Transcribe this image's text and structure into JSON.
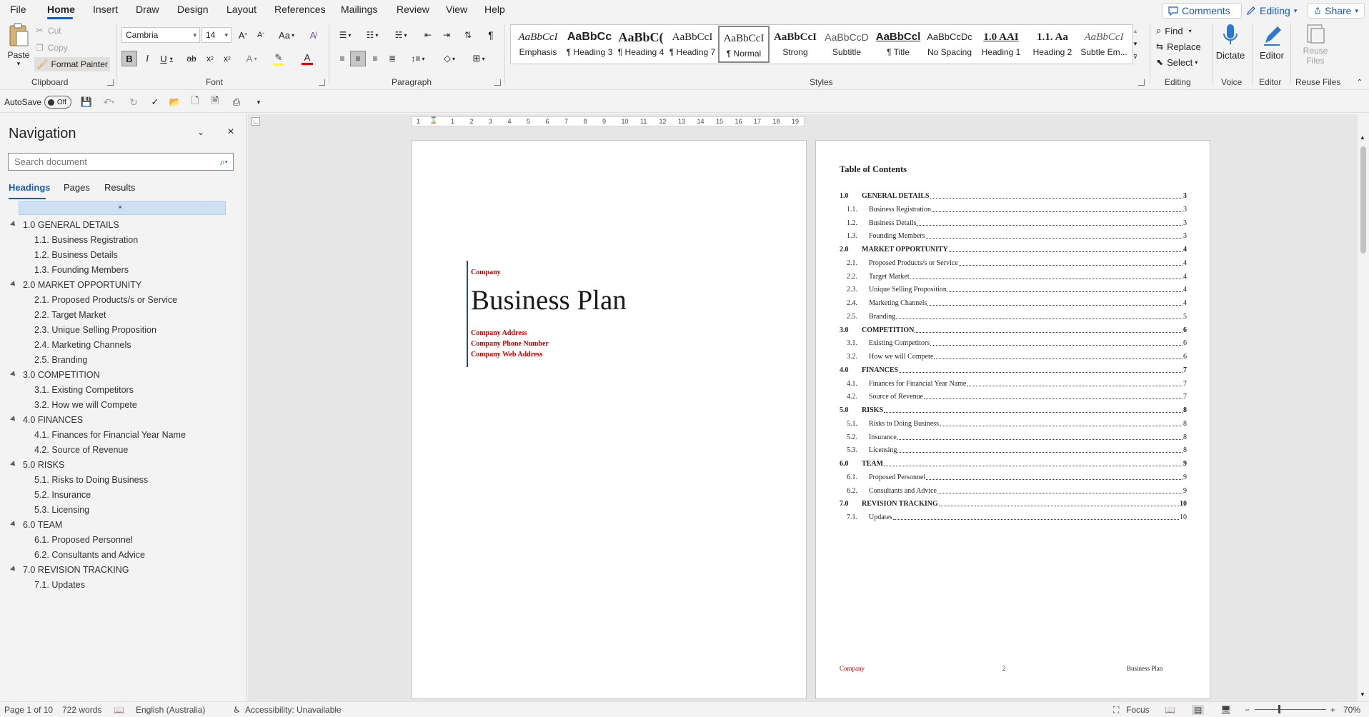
{
  "menu": {
    "tabs": [
      "File",
      "Home",
      "Insert",
      "Draw",
      "Design",
      "Layout",
      "References",
      "Mailings",
      "Review",
      "View",
      "Help"
    ],
    "comments_label": "Comments",
    "editing_label": "Editing",
    "share_label": "Share"
  },
  "ribbon": {
    "clipboard": {
      "paste": "Paste",
      "cut": "Cut",
      "copy": "Copy",
      "format_painter": "Format Painter",
      "group": "Clipboard"
    },
    "font": {
      "name": "Cambria",
      "size": "14",
      "group": "Font",
      "change_case": "Aa"
    },
    "paragraph": {
      "group": "Paragraph"
    },
    "styles": {
      "group": "Styles",
      "items": [
        {
          "preview": "AaBbCcI",
          "name": "Emphasis"
        },
        {
          "preview": "AaBbCc",
          "name": "¶ Heading 3"
        },
        {
          "preview": "AaBbC(",
          "name": "¶ Heading 4"
        },
        {
          "preview": "AaBbCcI",
          "name": "¶ Heading 7"
        },
        {
          "preview": "AaBbCcI",
          "name": "¶ Normal"
        },
        {
          "preview": "AaBbCcI",
          "name": "Strong"
        },
        {
          "preview": "AaBbCcD",
          "name": "Subtitle"
        },
        {
          "preview": "AaBbCcl",
          "name": "¶ Title"
        },
        {
          "preview": "AaBbCcDc",
          "name": "No Spacing"
        },
        {
          "preview": "1.0  AAI",
          "name": "Heading 1"
        },
        {
          "preview": "1.1.  Aa",
          "name": "Heading 2"
        },
        {
          "preview": "AaBbCcI",
          "name": "Subtle Em..."
        }
      ]
    },
    "editing": {
      "find": "Find",
      "replace": "Replace",
      "select": "Select",
      "group": "Editing"
    },
    "voice": {
      "dictate": "Dictate",
      "group": "Voice"
    },
    "editor": {
      "label": "Editor",
      "group": "Editor"
    },
    "reuse": {
      "label1": "Reuse",
      "label2": "Files",
      "group": "Reuse Files"
    }
  },
  "qat": {
    "autosave": "AutoSave",
    "toggle": "Off"
  },
  "nav": {
    "title": "Navigation",
    "search_placeholder": "Search document",
    "tabs": [
      "Headings",
      "Pages",
      "Results"
    ],
    "items": [
      {
        "level": 1,
        "label": "1.0 GENERAL DETAILS"
      },
      {
        "level": 2,
        "label": "1.1. Business Registration"
      },
      {
        "level": 2,
        "label": "1.2. Business Details"
      },
      {
        "level": 2,
        "label": "1.3. Founding Members"
      },
      {
        "level": 1,
        "label": "2.0 MARKET OPPORTUNITY"
      },
      {
        "level": 2,
        "label": "2.1. Proposed Products/s or Service"
      },
      {
        "level": 2,
        "label": "2.2. Target Market"
      },
      {
        "level": 2,
        "label": "2.3. Unique Selling Proposition"
      },
      {
        "level": 2,
        "label": "2.4. Marketing Channels"
      },
      {
        "level": 2,
        "label": "2.5. Branding"
      },
      {
        "level": 1,
        "label": "3.0 COMPETITION"
      },
      {
        "level": 2,
        "label": "3.1. Existing Competitors"
      },
      {
        "level": 2,
        "label": "3.2. How we will Compete"
      },
      {
        "level": 1,
        "label": "4.0 FINANCES"
      },
      {
        "level": 2,
        "label": "4.1. Finances for Financial Year Name"
      },
      {
        "level": 2,
        "label": "4.2. Source of Revenue"
      },
      {
        "level": 1,
        "label": "5.0 RISKS"
      },
      {
        "level": 2,
        "label": "5.1. Risks to Doing Business"
      },
      {
        "level": 2,
        "label": "5.2. Insurance"
      },
      {
        "level": 2,
        "label": "5.3. Licensing"
      },
      {
        "level": 1,
        "label": "6.0 TEAM"
      },
      {
        "level": 2,
        "label": "6.1. Proposed Personnel"
      },
      {
        "level": 2,
        "label": "6.2. Consultants and Advice"
      },
      {
        "level": 1,
        "label": "7.0 REVISION TRACKING"
      },
      {
        "level": 2,
        "label": "7.1. Updates"
      }
    ]
  },
  "ruler": {
    "ticks": [
      "1",
      "1",
      "2",
      "3",
      "4",
      "5",
      "6",
      "7",
      "8",
      "9",
      "10",
      "11",
      "12",
      "13",
      "14",
      "15",
      "16",
      "17",
      "18",
      "19"
    ]
  },
  "cover": {
    "company": "Company",
    "title": "Business Plan",
    "address": "Company Address",
    "phone": "Company Phone Number",
    "web": "Company Web Address"
  },
  "toc": {
    "heading": "Table of Contents",
    "entries": [
      {
        "num": "1.0",
        "title": "GENERAL DETAILS",
        "page": "3",
        "level": 1
      },
      {
        "num": "1.1.",
        "title": "Business Registration",
        "page": "3",
        "level": 2
      },
      {
        "num": "1.2.",
        "title": "Business Details",
        "page": "3",
        "level": 2
      },
      {
        "num": "1.3.",
        "title": "Founding Members",
        "page": "3",
        "level": 2
      },
      {
        "num": "2.0",
        "title": "MARKET OPPORTUNITY",
        "page": "4",
        "level": 1
      },
      {
        "num": "2.1.",
        "title": "Proposed Products/s or Service",
        "page": "4",
        "level": 2
      },
      {
        "num": "2.2.",
        "title": "Target Market",
        "page": "4",
        "level": 2
      },
      {
        "num": "2.3.",
        "title": "Unique Selling Proposition",
        "page": "4",
        "level": 2
      },
      {
        "num": "2.4.",
        "title": "Marketing Channels",
        "page": "4",
        "level": 2
      },
      {
        "num": "2.5.",
        "title": "Branding",
        "page": "5",
        "level": 2
      },
      {
        "num": "3.0",
        "title": "COMPETITION",
        "page": "6",
        "level": 1
      },
      {
        "num": "3.1.",
        "title": "Existing Competitors",
        "page": "6",
        "level": 2
      },
      {
        "num": "3.2.",
        "title": "How we will Compete",
        "page": "6",
        "level": 2
      },
      {
        "num": "4.0",
        "title": "FINANCES",
        "page": "7",
        "level": 1
      },
      {
        "num": "4.1.",
        "title": "Finances for Financial Year Name",
        "page": "7",
        "level": 2
      },
      {
        "num": "4.2.",
        "title": "Source of Revenue",
        "page": "7",
        "level": 2
      },
      {
        "num": "5.0",
        "title": "RISKS",
        "page": "8",
        "level": 1
      },
      {
        "num": "5.1.",
        "title": "Risks to Doing Business",
        "page": "8",
        "level": 2
      },
      {
        "num": "5.2.",
        "title": "Insurance",
        "page": "8",
        "level": 2
      },
      {
        "num": "5.3.",
        "title": "Licensing",
        "page": "8",
        "level": 2
      },
      {
        "num": "6.0",
        "title": "TEAM",
        "page": "9",
        "level": 1
      },
      {
        "num": "6.1.",
        "title": "Proposed Personnel",
        "page": "9",
        "level": 2
      },
      {
        "num": "6.2.",
        "title": "Consultants and Advice",
        "page": "9",
        "level": 2
      },
      {
        "num": "7.0",
        "title": "REVISION TRACKING",
        "page": "10",
        "level": 1
      },
      {
        "num": "7.1.",
        "title": "Updates",
        "page": "10",
        "level": 2
      }
    ],
    "footer_left": "Company",
    "footer_center": "2",
    "footer_right": "Business Plan"
  },
  "status": {
    "page": "Page 1 of 10",
    "words": "722 words",
    "language": "English (Australia)",
    "accessibility": "Accessibility: Unavailable",
    "focus": "Focus",
    "zoom": "70%"
  },
  "colors": {
    "accent": "#185abd",
    "red_text": "#c00000",
    "cover_bar": "#1f4e79"
  }
}
